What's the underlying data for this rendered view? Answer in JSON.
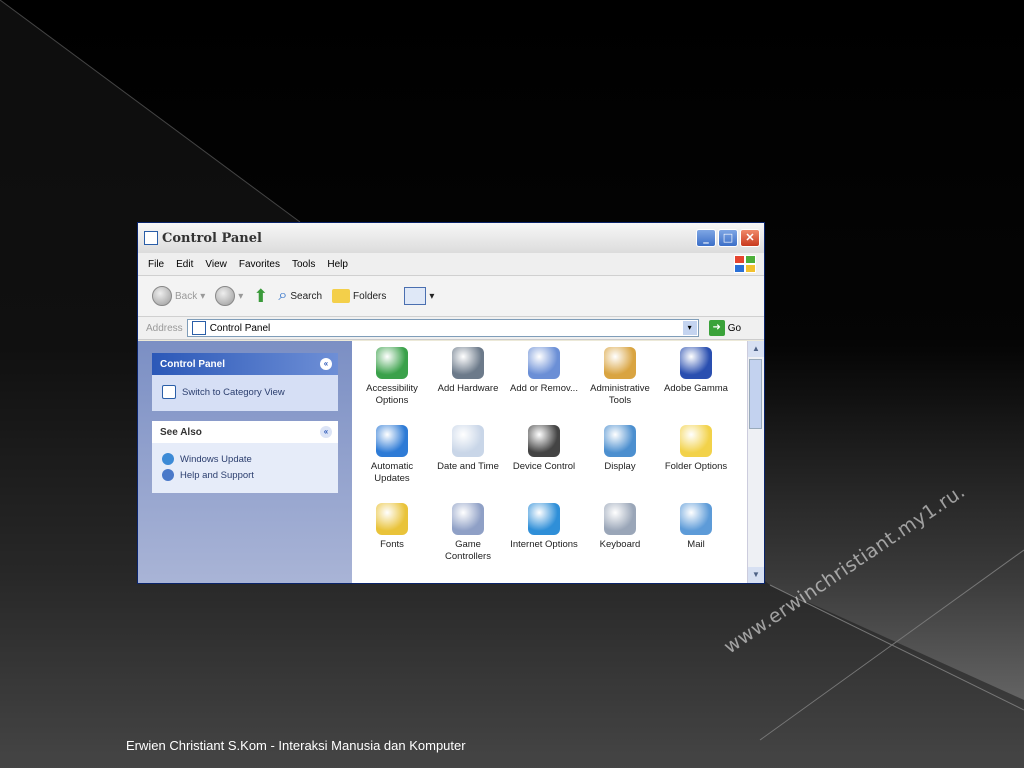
{
  "window": {
    "title": "Control Panel",
    "menu": [
      "File",
      "Edit",
      "View",
      "Favorites",
      "Tools",
      "Help"
    ],
    "toolbar": {
      "back": "Back",
      "search": "Search",
      "folders": "Folders"
    },
    "address": {
      "label": "Address",
      "value": "Control Panel",
      "go": "Go"
    }
  },
  "sidebar": {
    "control_panel": {
      "title": "Control Panel",
      "link": "Switch to Category View"
    },
    "see_also": {
      "title": "See Also",
      "links": [
        "Windows Update",
        "Help and Support"
      ]
    }
  },
  "icons": [
    {
      "label": "Accessibility Options",
      "icon": "accessibility-icon",
      "color": "#3aa14a"
    },
    {
      "label": "Add Hardware",
      "icon": "add-hardware-icon",
      "color": "#6c7a8a"
    },
    {
      "label": "Add or Remov...",
      "icon": "add-remove-programs-icon",
      "color": "#6b8fd6"
    },
    {
      "label": "Administrative Tools",
      "icon": "administrative-tools-icon",
      "color": "#d9a441"
    },
    {
      "label": "Adobe Gamma",
      "icon": "adobe-gamma-icon",
      "color": "#2a4fb0"
    },
    {
      "label": "Automatic Updates",
      "icon": "automatic-updates-icon",
      "color": "#2e7bd6"
    },
    {
      "label": "Date and Time",
      "icon": "date-time-icon",
      "color": "#c9d6e8"
    },
    {
      "label": "Device Control",
      "icon": "device-control-icon",
      "color": "#444444"
    },
    {
      "label": "Display",
      "icon": "display-icon",
      "color": "#4c8fcf"
    },
    {
      "label": "Folder Options",
      "icon": "folder-options-icon",
      "color": "#f2d24a"
    },
    {
      "label": "Fonts",
      "icon": "fonts-icon",
      "color": "#e9c33a"
    },
    {
      "label": "Game Controllers",
      "icon": "game-controllers-icon",
      "color": "#8fa0c6"
    },
    {
      "label": "Internet Options",
      "icon": "internet-options-icon",
      "color": "#2f8fd8"
    },
    {
      "label": "Keyboard",
      "icon": "keyboard-icon",
      "color": "#9aa6b8"
    },
    {
      "label": "Mail",
      "icon": "mail-icon",
      "color": "#5d9bd8"
    }
  ],
  "footer": "Erwien Christiant S.Kom - Interaksi Manusia dan Komputer",
  "watermark": "www.erwinchristiant.my1.ru."
}
